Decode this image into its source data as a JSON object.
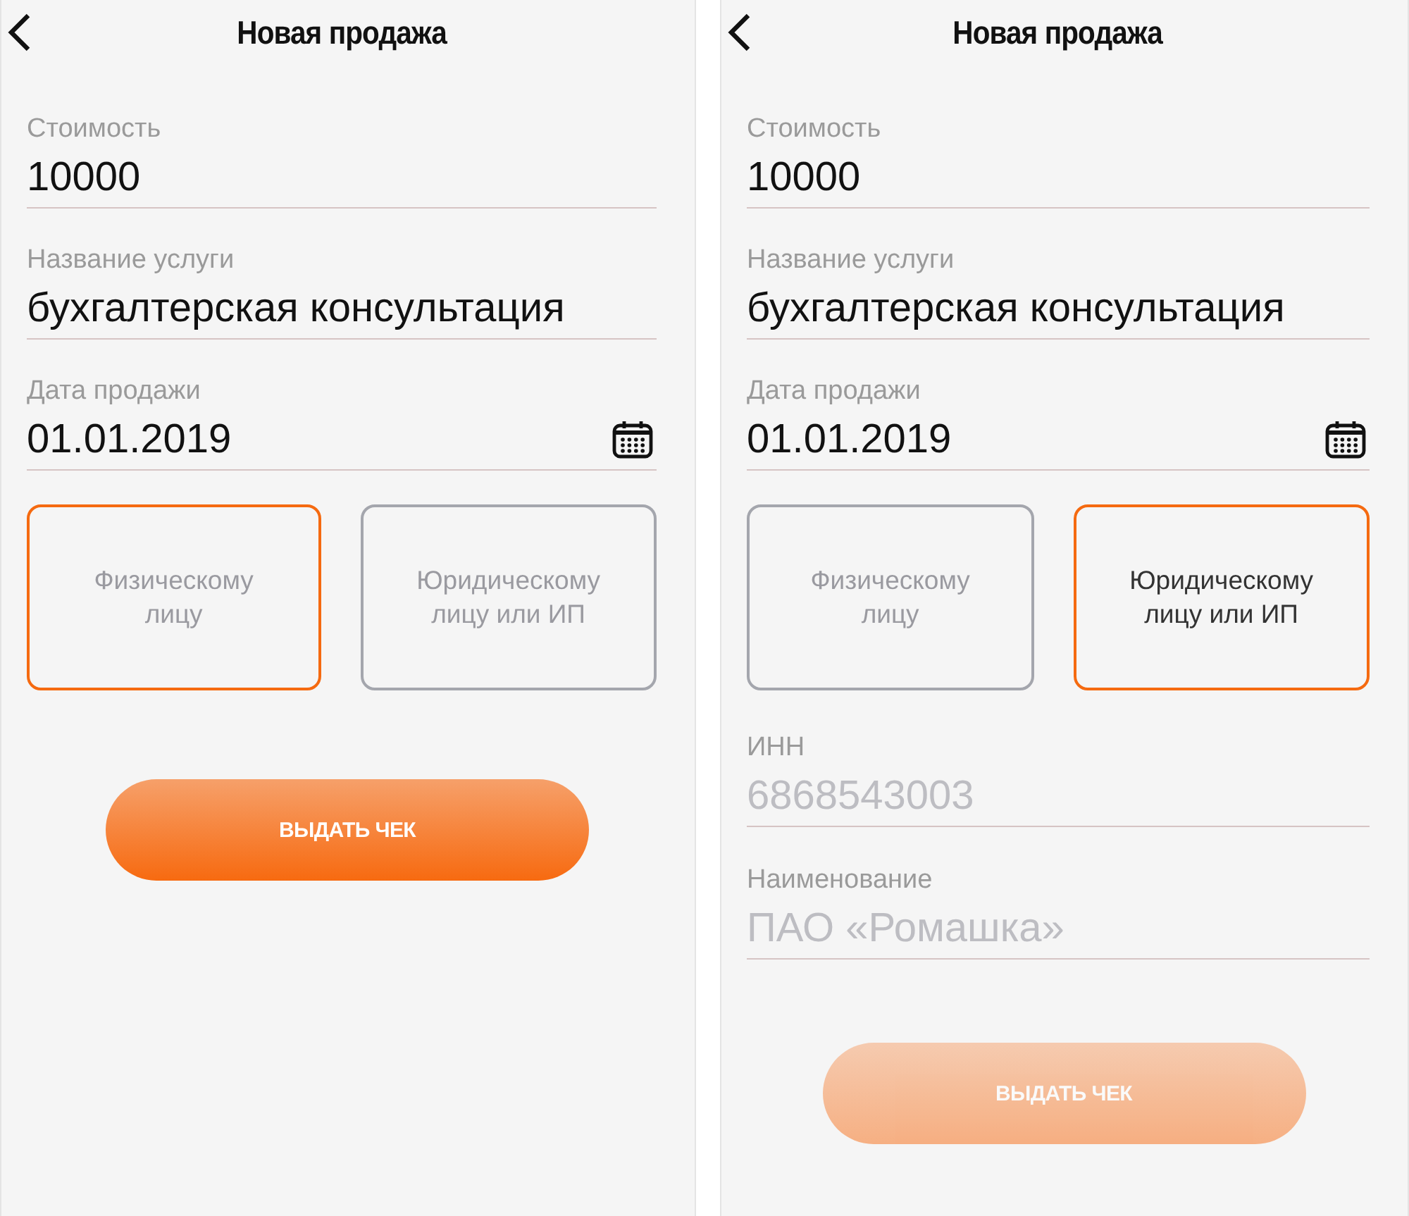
{
  "screens": [
    {
      "title": "Новая продажа",
      "fields": [
        {
          "kind": "text",
          "label": "Стоимость",
          "value": "10000"
        },
        {
          "kind": "text",
          "label": "Название услуги",
          "value": "бухгалтерская консультация"
        },
        {
          "kind": "date",
          "label": "Дата продажи",
          "value": "01.01.2019"
        }
      ],
      "options": [
        {
          "label": "Физическому лицу",
          "selected": true
        },
        {
          "label": "Юридическому лицу или ИП",
          "selected": false
        }
      ],
      "button": {
        "label": "ВЫДАТЬ ЧЕК",
        "disabled": false
      }
    },
    {
      "title": "Новая продажа",
      "fields": [
        {
          "kind": "text",
          "label": "Стоимость",
          "value": "10000"
        },
        {
          "kind": "text",
          "label": "Название услуги",
          "value": "бухгалтерская консультация"
        },
        {
          "kind": "date",
          "label": "Дата продажи",
          "value": "01.01.2019"
        }
      ],
      "options": [
        {
          "label": "Физическому лицу",
          "selected": false
        },
        {
          "label": "Юридическому лицу или ИП",
          "selected": true
        }
      ],
      "extra_fields": [
        {
          "label": "ИНН",
          "placeholder": "6868543003"
        },
        {
          "label": "Наименование",
          "placeholder": "ПАО «Ромашка»"
        }
      ],
      "button": {
        "label": "ВЫДАТЬ ЧЕК",
        "disabled": true
      }
    }
  ]
}
